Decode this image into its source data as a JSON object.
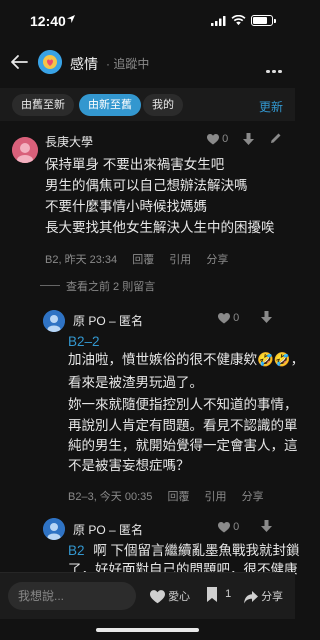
{
  "status": {
    "time": "12:40",
    "location_icon": "location-arrow-icon",
    "battery_pct": 0.7
  },
  "nav": {
    "title": "感情",
    "follow_status": "· 追蹤中"
  },
  "sort": {
    "tabs": [
      "由舊至新",
      "由新至舊",
      "我的"
    ],
    "active": "由新至舊",
    "update_label": "更新"
  },
  "comment": {
    "author": "長庚大學",
    "likes": "0",
    "lines": [
      "保持單身 不要出來禍害女生吧",
      "男生的偶焦可以自己想辦法解決嗎",
      "不要什麼事情小時候找媽媽",
      "長大要找其他女生解決人生中的困擾唉"
    ],
    "floor_time": "B2, 昨天 23:34",
    "actions": [
      "回覆",
      "引用",
      "分享"
    ],
    "view_more": "查看之前 2 則留言"
  },
  "replies": [
    {
      "author": "原 PO – 匿名",
      "likes": "0",
      "ref": "B2–2",
      "lines": [
        "加油啦，憤世嫉俗的很不健康欸🤣🤣，",
        "看來是被渣男玩過了。",
        "妳一來就隨便指控別人不知道的事情，",
        "再說別人肯定有問題。看見不認識的單",
        "純的男生，就開始覺得一定會害人，這",
        "不是被害妄想症嗎？"
      ],
      "floor_time": "B2–3, 今天 00:35",
      "actions": [
        "回覆",
        "引用",
        "分享"
      ]
    },
    {
      "author": "原 PO – 匿名",
      "likes": "0",
      "ref": "B2",
      "lines": [
        "啊 下個留言繼續亂墨魚戰我就封鎖",
        "了，好好面對自己的問題吧，很不健康"
      ]
    }
  ],
  "bottom": {
    "placeholder": "我想說...",
    "love_label": "愛心",
    "bookmark_count": "1",
    "share_label": "分享"
  }
}
